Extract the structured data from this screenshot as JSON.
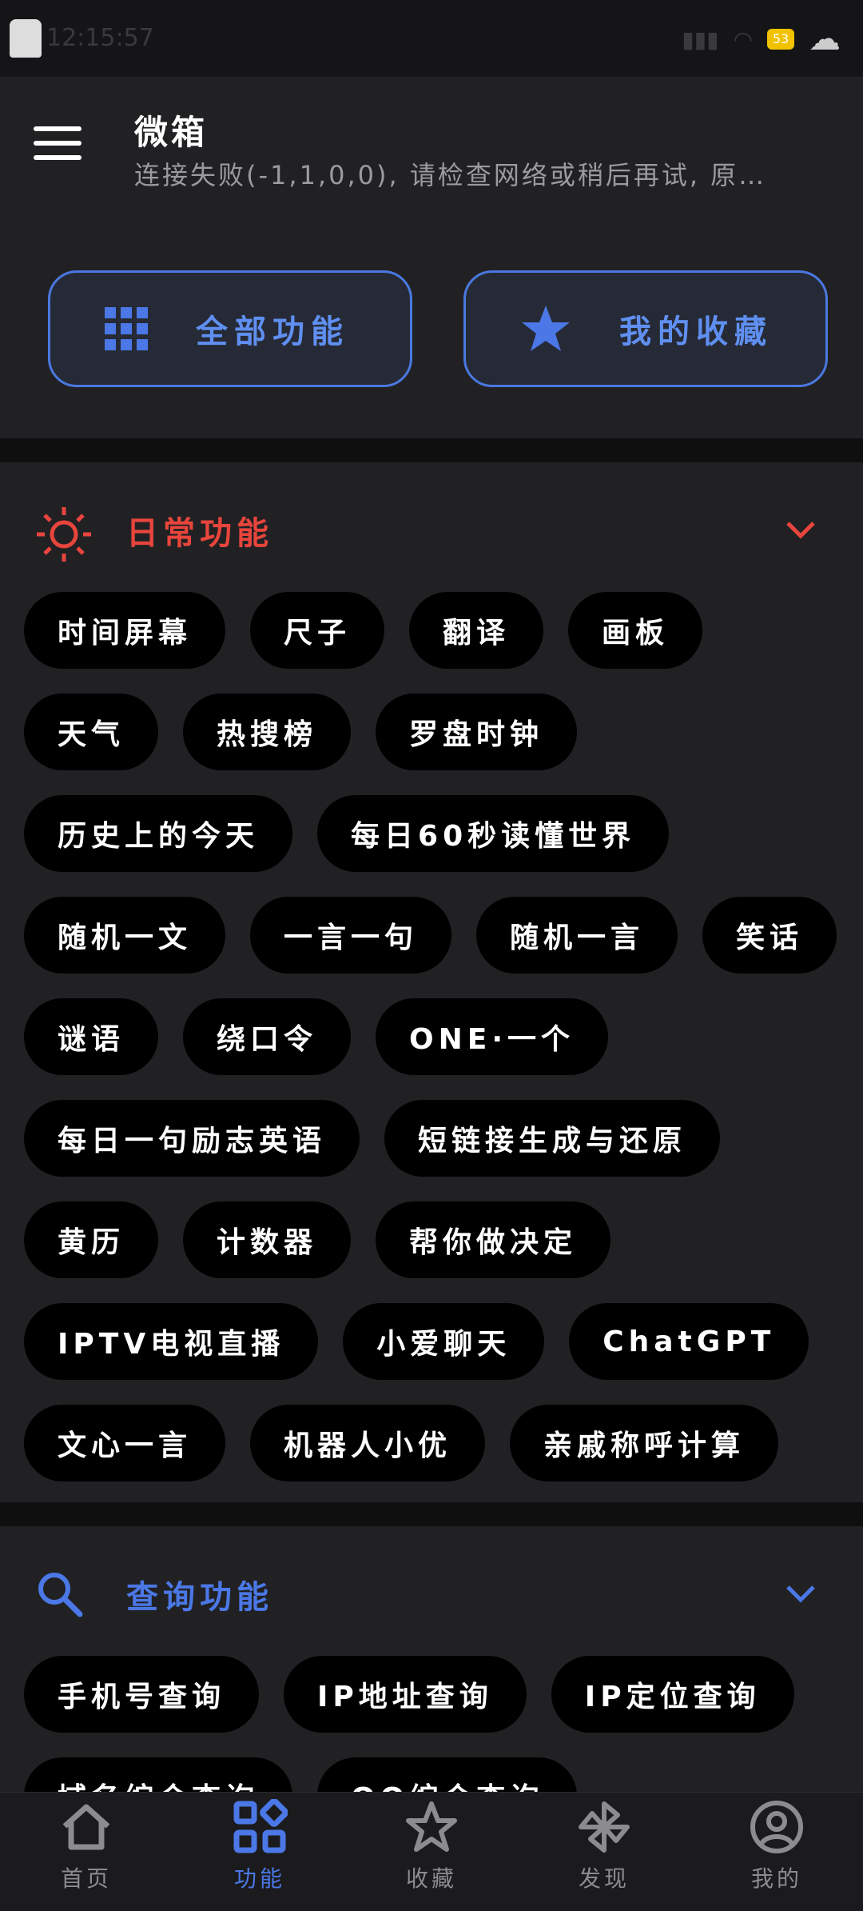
{
  "status": {
    "time": "12:15:57",
    "battery": "53"
  },
  "header": {
    "title": "微箱",
    "subtitle": "连接失败(-1,1,0,0), 请检查网络或稍后再试, 原…"
  },
  "quick_buttons": {
    "all": "全部功能",
    "favorites": "我的收藏"
  },
  "accent": "#4b78e6",
  "daily_color": "#e8453c",
  "sections": {
    "daily": {
      "title": "日常功能",
      "chips": [
        "时间屏幕",
        "尺子",
        "翻译",
        "画板",
        "天气",
        "热搜榜",
        "罗盘时钟",
        "历史上的今天",
        "每日60秒读懂世界",
        "随机一文",
        "一言一句",
        "随机一言",
        "笑话",
        "谜语",
        "绕口令",
        "ONE·一个",
        "每日一句励志英语",
        "短链接生成与还原",
        "黄历",
        "计数器",
        "帮你做决定",
        "IPTV电视直播",
        "小爱聊天",
        "ChatGPT",
        "文心一言",
        "机器人小优",
        "亲戚称呼计算"
      ]
    },
    "query": {
      "title": "查询功能",
      "chips": [
        "手机号查询",
        "IP地址查询",
        "IP定位查询",
        "域名综合查询",
        "QQ综合查询"
      ]
    }
  },
  "nav": {
    "home": "首页",
    "functions": "功能",
    "favorites": "收藏",
    "discover": "发现",
    "mine": "我的"
  }
}
